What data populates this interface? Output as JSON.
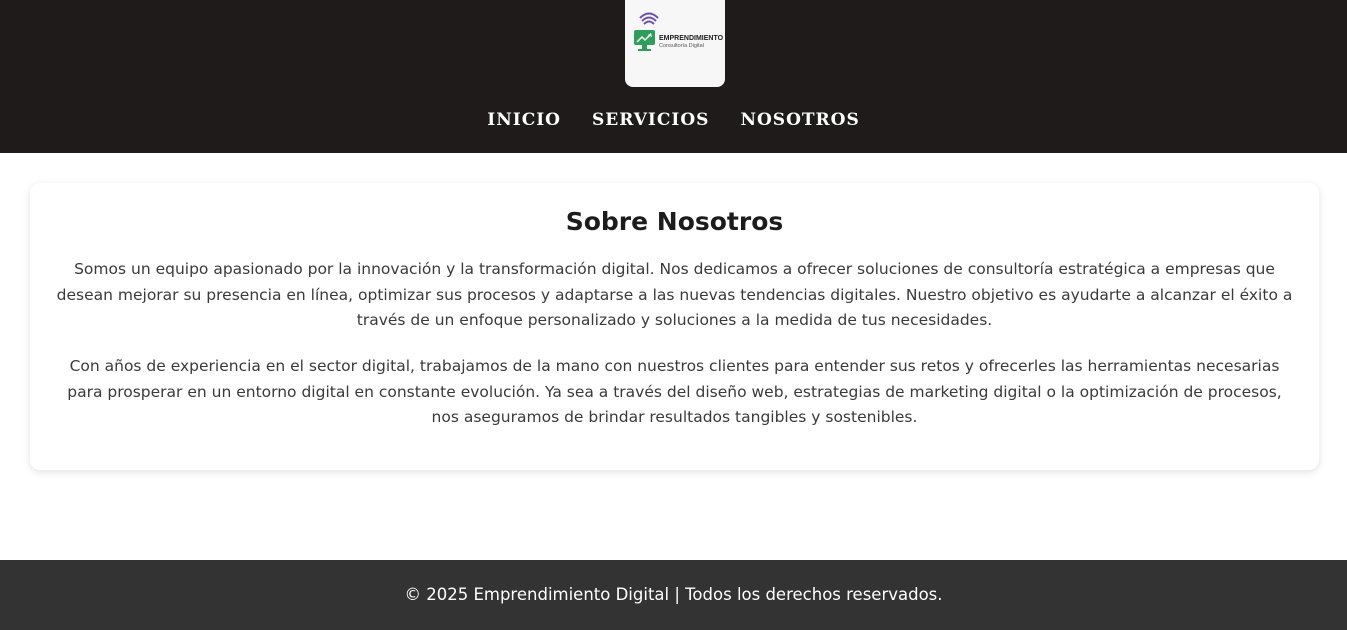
{
  "brand": {
    "logo_icon": "monitor-growth-icon",
    "logo_title": "EMPRENDIMIENTO",
    "logo_subtitle": "Consultoría Digital"
  },
  "nav": {
    "items": [
      {
        "label": "INICIO"
      },
      {
        "label": "SERVICIOS"
      },
      {
        "label": "NOSOTROS"
      }
    ]
  },
  "about": {
    "title": "Sobre Nosotros",
    "paragraph1": "Somos un equipo apasionado por la innovación y la transformación digital. Nos dedicamos a ofrecer soluciones de consultoría estratégica a empresas que desean mejorar su presencia en línea, optimizar sus procesos y adaptarse a las nuevas tendencias digitales. Nuestro objetivo es ayudarte a alcanzar el éxito a través de un enfoque personalizado y soluciones a la medida de tus necesidades.",
    "paragraph2": "Con años de experiencia en el sector digital, trabajamos de la mano con nuestros clientes para entender sus retos y ofrecerles las herramientas necesarias para prosperar en un entorno digital en constante evolución. Ya sea a través del diseño web, estrategias de marketing digital o la optimización de procesos, nos aseguramos de brindar resultados tangibles y sostenibles."
  },
  "footer": {
    "text": "© 2025 Emprendimiento Digital | Todos los derechos reservados."
  },
  "colors": {
    "header_bg": "#1f1b1b",
    "footer_bg": "#333333",
    "logo_green": "#2e9e5b",
    "logo_purple": "#6a4fb0"
  }
}
